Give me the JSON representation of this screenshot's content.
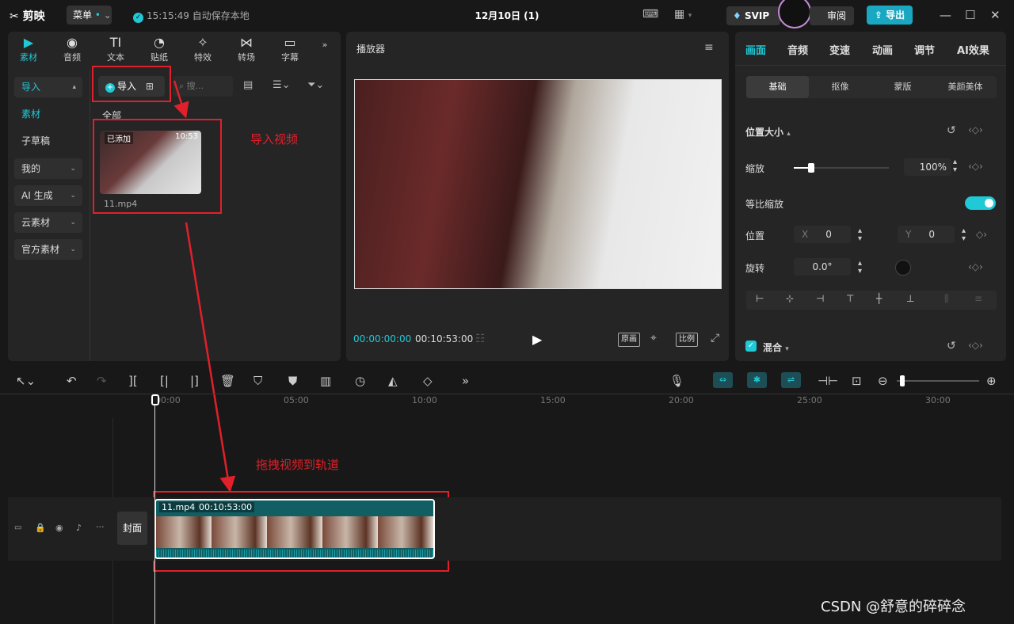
{
  "titlebar": {
    "logo": "剪映",
    "menu": "菜单",
    "save_status": "15:15:49 自动保存本地",
    "doc_title": "12月10日 (1)",
    "svip": "SVIP",
    "review": "审阅",
    "export": "导出"
  },
  "media_tabs": [
    {
      "label": "素材",
      "icon": "media-icon"
    },
    {
      "label": "音频",
      "icon": "audio-icon"
    },
    {
      "label": "文本",
      "icon": "text-icon"
    },
    {
      "label": "贴纸",
      "icon": "sticker-icon"
    },
    {
      "label": "特效",
      "icon": "effects-icon"
    },
    {
      "label": "转场",
      "icon": "transition-icon"
    },
    {
      "label": "字幕",
      "icon": "subtitle-icon"
    }
  ],
  "sidebar": {
    "items": [
      {
        "label": "导入"
      },
      {
        "label": "素材"
      },
      {
        "label": "子草稿"
      },
      {
        "label": "我的"
      },
      {
        "label": "AI 生成"
      },
      {
        "label": "云素材"
      },
      {
        "label": "官方素材"
      }
    ]
  },
  "media": {
    "import_label": "导入",
    "search_placeholder": "搜...",
    "section_all": "全部",
    "item": {
      "badge": "已添加",
      "duration": "10:53",
      "filename": "11.mp4"
    }
  },
  "annotations": {
    "import_video": "导入视频",
    "drag_to_track": "拖拽视频到轨道"
  },
  "player": {
    "title": "播放器",
    "current_time": "00:00:00:00",
    "total_time": "00:10:53:00",
    "btn_original": "原画",
    "btn_ratio": "比例"
  },
  "inspector": {
    "tabs": [
      "画面",
      "音频",
      "变速",
      "动画",
      "调节",
      "AI效果"
    ],
    "subtabs": [
      "基础",
      "抠像",
      "蒙版",
      "美颜美体"
    ],
    "section_position_size": "位置大小",
    "scale_label": "缩放",
    "scale_value": "100%",
    "scale_slider": 0.18,
    "uniform_scale_label": "等比缩放",
    "position_label": "位置",
    "x_label": "X",
    "x_value": "0",
    "y_label": "Y",
    "y_value": "0",
    "rotation_label": "旋转",
    "rotation_value": "0.0°",
    "blend_label": "混合"
  },
  "timeline": {
    "ruler": [
      "00:00",
      "05:00",
      "10:00",
      "15:00",
      "20:00",
      "25:00",
      "30:00"
    ],
    "clip_name": "11.mp4",
    "clip_duration": "00:10:53:00",
    "cover_label": "封面"
  },
  "watermark": "CSDN @舒意的碎碎念",
  "colors": {
    "accent": "#20c9d6",
    "annotation_red": "#e0202a"
  }
}
